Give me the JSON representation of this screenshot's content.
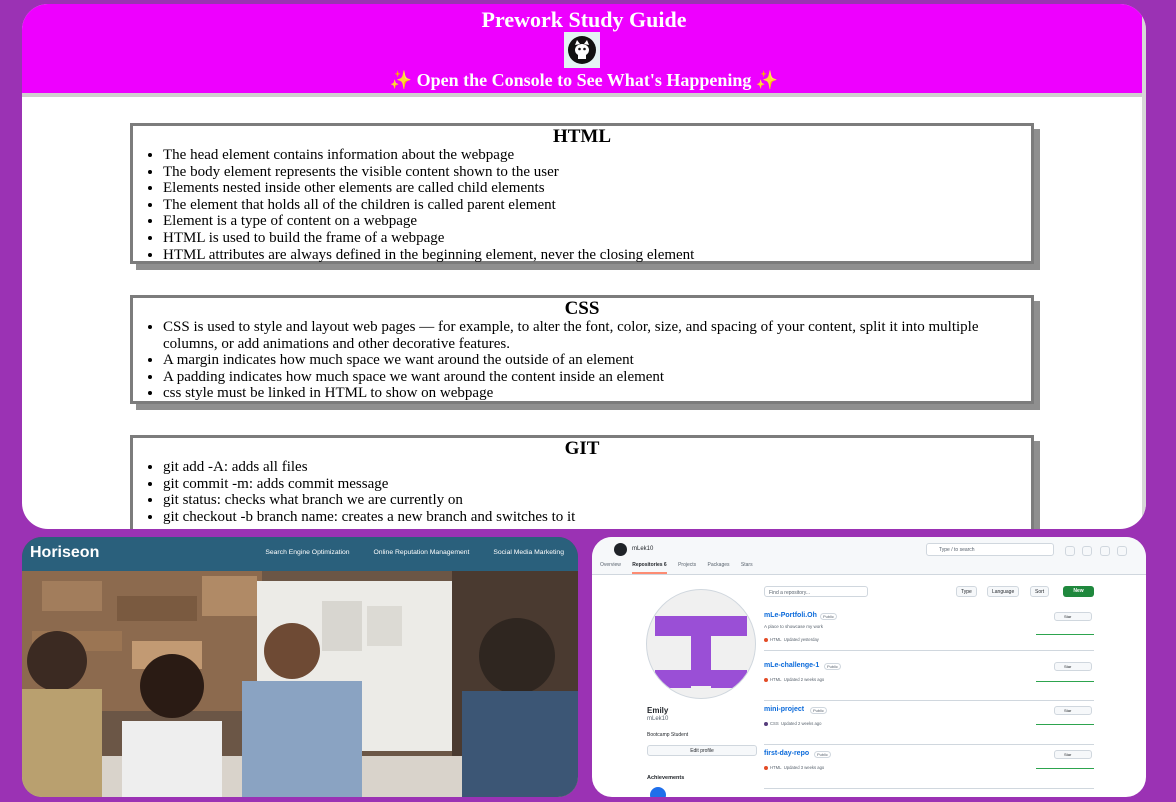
{
  "guide": {
    "title": "Prework Study Guide",
    "subtitle_text": "Open the Console to See What's Happening",
    "spark_glyph": "✨",
    "logo_icon": "cat-icon",
    "sections": [
      {
        "heading": "HTML",
        "items": [
          "The head element contains information about the webpage",
          "The body element represents the visible content shown to the user",
          "Elements nested inside other elements are called child elements",
          "The element that holds all of the children is called parent element",
          "Element is a type of content on a webpage",
          "HTML is used to build the frame of a webpage",
          "HTML attributes are always defined in the beginning element, never the closing element"
        ]
      },
      {
        "heading": "CSS",
        "items": [
          "CSS is used to style and layout web pages — for example, to alter the font, color, size, and spacing of your content, split it into multiple columns, or add animations and other decorative features.",
          "A margin indicates how much space we want around the outside of an element",
          "A padding indicates how much space we want around the content inside an element",
          "css style must be linked in HTML to show on webpage"
        ]
      },
      {
        "heading": "GIT",
        "items": [
          "git add -A: adds all files",
          "git commit -m: adds commit message",
          "git status: checks what branch we are currently on",
          "git checkout -b branch name: creates a new branch and switches to it"
        ]
      }
    ],
    "colors": {
      "header": "#ee00ff",
      "background": "#9b32b4"
    }
  },
  "horiseon": {
    "brand": "Horiseon",
    "nav": [
      "Search Engine Optimization",
      "Online Reputation Management",
      "Social Media Marketing"
    ],
    "nav_color": "#2a607c"
  },
  "github": {
    "top_username": "mLek10",
    "search_placeholder": "Type / to search",
    "tabs": [
      "Overview",
      "Repositories 6",
      "Projects",
      "Packages",
      "Stars"
    ],
    "profile_name": "Emily",
    "profile_login": "mLek10",
    "bio": "Bootcamp Student",
    "edit_label": "Edit profile",
    "achievements_label": "Achievements",
    "find_placeholder": "Find a repository...",
    "filters": [
      "Type",
      "Language",
      "Sort"
    ],
    "new_label": "New",
    "star_label": "Star",
    "repos": [
      {
        "name": "mLe-Portfoli.Oh",
        "visibility": "Public",
        "desc": "A place to showcase my work",
        "lang": "HTML",
        "lang_color": "#e34c26",
        "updated": "Updated yesterday"
      },
      {
        "name": "mLe-challenge-1",
        "visibility": "Public",
        "desc": "",
        "lang": "HTML",
        "lang_color": "#e34c26",
        "updated": "Updated 2 weeks ago"
      },
      {
        "name": "mini-project",
        "visibility": "Public",
        "desc": "",
        "lang": "CSS",
        "lang_color": "#563d7c",
        "updated": "Updated 2 weeks ago"
      },
      {
        "name": "first-day-repo",
        "visibility": "Public",
        "desc": "",
        "lang": "HTML",
        "lang_color": "#e34c26",
        "updated": "Updated 3 weeks ago"
      }
    ]
  }
}
